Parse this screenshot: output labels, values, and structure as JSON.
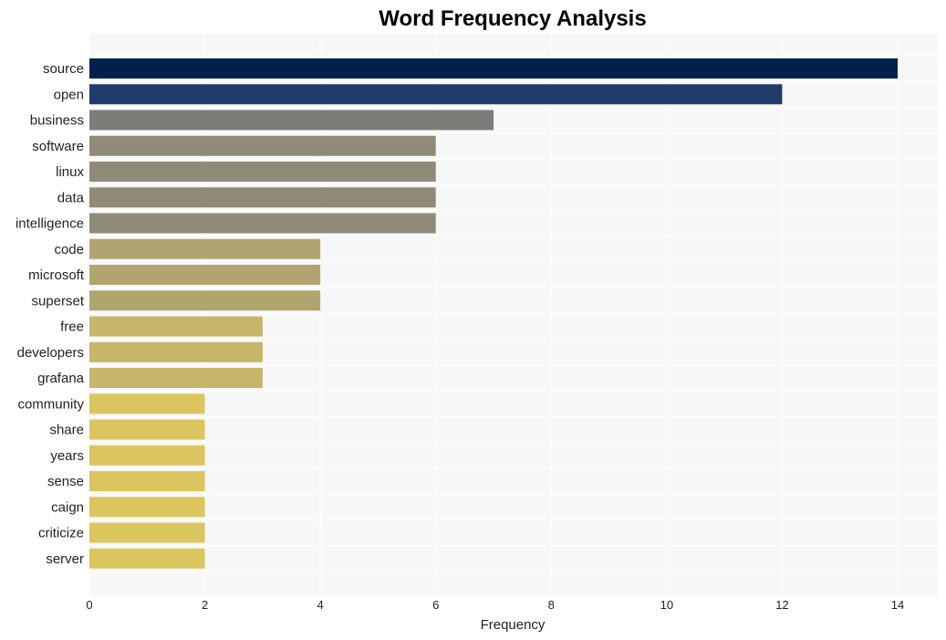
{
  "chart_data": {
    "type": "bar",
    "orientation": "horizontal",
    "title": "Word Frequency Analysis",
    "xlabel": "Frequency",
    "ylabel": "",
    "xlim": [
      0,
      14.7
    ],
    "xticks": [
      0,
      2,
      4,
      6,
      8,
      10,
      12,
      14
    ],
    "grid": true,
    "legend": "none",
    "categories": [
      "source",
      "open",
      "business",
      "software",
      "linux",
      "data",
      "intelligence",
      "code",
      "microsoft",
      "superset",
      "free",
      "developers",
      "grafana",
      "community",
      "share",
      "years",
      "sense",
      "caign",
      "criticize",
      "server"
    ],
    "values": [
      14,
      12,
      7,
      6,
      6,
      6,
      6,
      4,
      4,
      4,
      3,
      3,
      3,
      2,
      2,
      2,
      2,
      2,
      2,
      2
    ],
    "colors": [
      "#00204c",
      "#213b6c",
      "#7e7c78",
      "#908a79",
      "#908a79",
      "#908a79",
      "#908a79",
      "#b1a56f",
      "#b1a56f",
      "#b1a56f",
      "#c6b66a",
      "#c6b66a",
      "#c6b66a",
      "#dbc55e",
      "#dbc55e",
      "#dbc55e",
      "#dbc55e",
      "#dbc55e",
      "#dbc55e",
      "#dbc55e"
    ]
  },
  "style": {
    "plot_background": "#f7f7f7",
    "grid_color": "#ffffff"
  }
}
